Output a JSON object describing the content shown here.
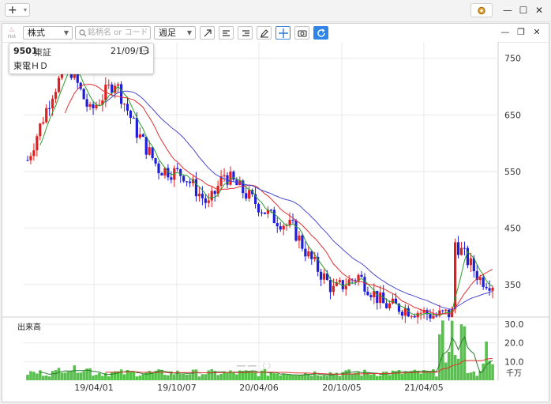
{
  "window": {
    "add_label": "+",
    "minimize": "—",
    "maximize": "☐",
    "close": "✕"
  },
  "toolbar": {
    "hot_label": "Hot",
    "market_select": "株式",
    "search_placeholder": "銘柄名 or コード",
    "period_select": "週足"
  },
  "panel": {
    "minimize": "—",
    "restore": "❐",
    "close": "✕"
  },
  "infobox": {
    "code": "9501",
    "market": "東証",
    "date": "21/09/13",
    "name": "東電ＨＤ"
  },
  "colors": {
    "up": "#e02020",
    "down": "#1f1fd8",
    "ma_short": "#2a9d2a",
    "ma_mid": "#e03030",
    "ma_long": "#4a4ad0",
    "volume": "#55c24a",
    "refresh": "#2f86e6"
  },
  "chart_data": {
    "type": "candlestick",
    "price_axis_ticks": [
      "750",
      "650",
      "550",
      "450",
      "350"
    ],
    "ylim": [
      294,
      779
    ],
    "volume_title": "出来高",
    "volume_axis_ticks": [
      "30.0",
      "20.0",
      "10.0"
    ],
    "volume_unit": "千万",
    "volume_ylim": [
      0,
      33
    ],
    "x_tick_labels": [
      "19/04/01",
      "19/10/07",
      "20/04/06",
      "20/10/05",
      "21/04/05"
    ],
    "moving_averages": [
      "short",
      "mid",
      "long"
    ]
  }
}
